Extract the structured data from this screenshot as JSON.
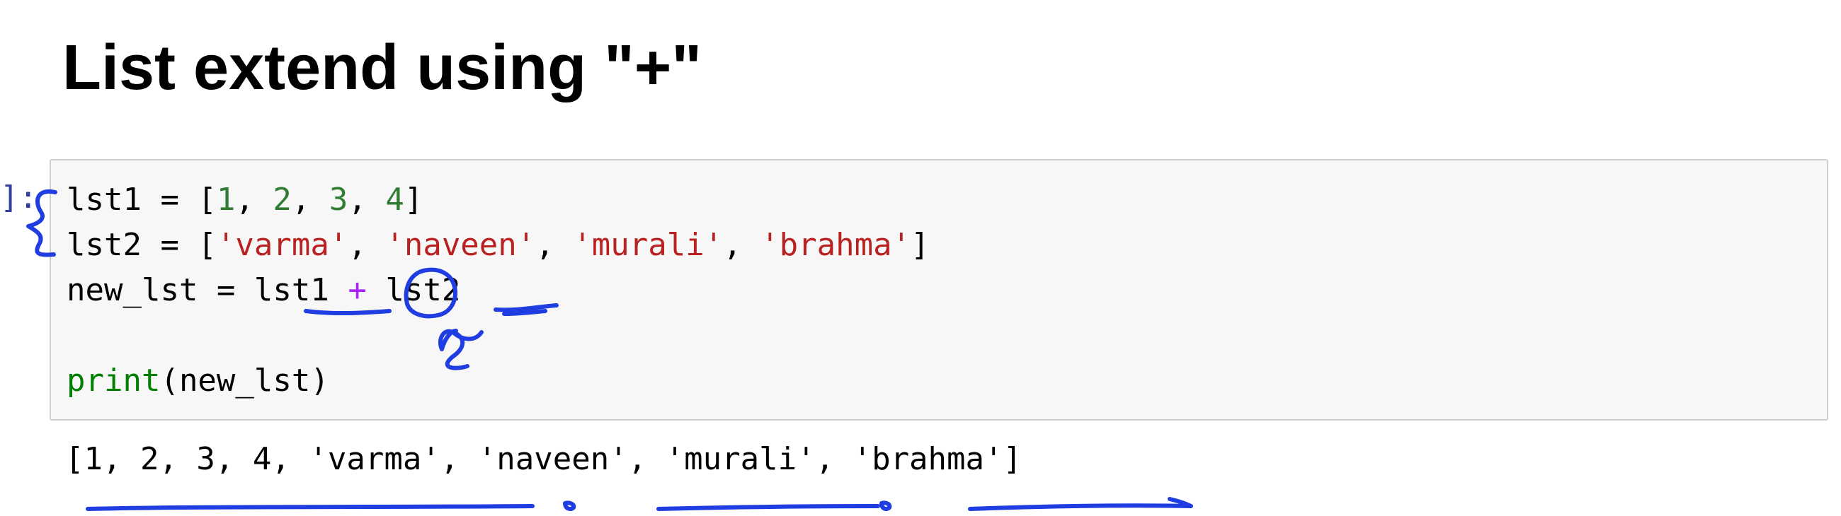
{
  "heading": "List extend using \"+\"",
  "cell": {
    "prompt": "]:",
    "lines": [
      [
        {
          "t": "plain",
          "v": "lst1 = ["
        },
        {
          "t": "num",
          "v": "1"
        },
        {
          "t": "plain",
          "v": ", "
        },
        {
          "t": "num",
          "v": "2"
        },
        {
          "t": "plain",
          "v": ", "
        },
        {
          "t": "num",
          "v": "3"
        },
        {
          "t": "plain",
          "v": ", "
        },
        {
          "t": "num",
          "v": "4"
        },
        {
          "t": "plain",
          "v": "]"
        }
      ],
      [
        {
          "t": "plain",
          "v": "lst2 = ["
        },
        {
          "t": "str",
          "v": "'varma'"
        },
        {
          "t": "plain",
          "v": ", "
        },
        {
          "t": "str",
          "v": "'naveen'"
        },
        {
          "t": "plain",
          "v": ", "
        },
        {
          "t": "str",
          "v": "'murali'"
        },
        {
          "t": "plain",
          "v": ", "
        },
        {
          "t": "str",
          "v": "'brahma'"
        },
        {
          "t": "plain",
          "v": "]"
        }
      ],
      [
        {
          "t": "plain",
          "v": "new_lst = lst1 "
        },
        {
          "t": "op",
          "v": "+"
        },
        {
          "t": "plain",
          "v": " lst2"
        }
      ],
      [],
      [
        {
          "t": "builtin",
          "v": "print"
        },
        {
          "t": "plain",
          "v": "(new_lst)"
        }
      ]
    ]
  },
  "output": "[1, 2, 3, 4, 'varma', 'naveen', 'murali', 'brahma']",
  "colors": {
    "number": "#2e7d32",
    "string": "#ba2121",
    "operator": "#aa22ff",
    "builtin": "#008000",
    "annotation_ink": "#1f3de0",
    "cell_background": "#f7f7f7"
  }
}
